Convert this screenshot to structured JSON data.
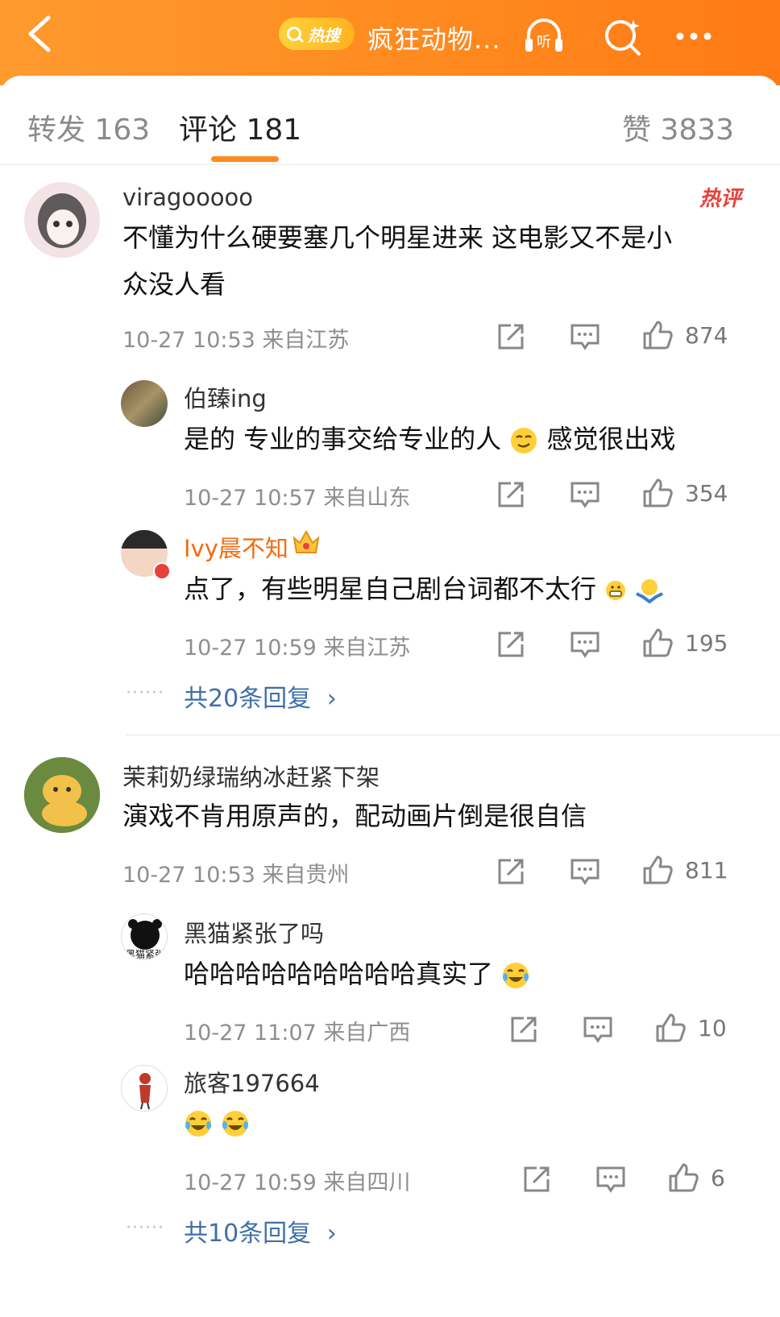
{
  "header": {
    "hot_search_label": "热搜",
    "title": "疯狂动物..."
  },
  "tabs": {
    "repost": "转发 163",
    "comments": "评论 181",
    "likes": "赞 3833"
  },
  "hot_badge": "热评",
  "comments": [
    {
      "user": "viragooooo",
      "text_line1": "不懂为什么硬要塞几个明星进来 这电影又不是小",
      "text_line2": "众没人看",
      "meta": "10-27 10:53  来自江苏",
      "likes": "874",
      "replies": [
        {
          "user": "伯臻ing",
          "text": "是的 专业的事交给专业的人",
          "text_after": "感觉很出戏",
          "meta": "10-27 10:57  来自山东",
          "likes": "354"
        },
        {
          "user": "Ivy晨不知",
          "text": "点了，有些明星自己剧台词都不太行",
          "meta": "10-27 10:59  来自江苏",
          "likes": "195"
        }
      ],
      "more": "共20条回复"
    },
    {
      "user": "茉莉奶绿瑞纳冰赶紧下架",
      "text": "演戏不肯用原声的，配动画片倒是很自信",
      "meta": "10-27 10:53  来自贵州",
      "likes": "811",
      "replies": [
        {
          "user": "黑猫紧张了吗",
          "avatar_text": "黑猫紧张",
          "text": "哈哈哈哈哈哈哈哈哈真实了",
          "meta": "10-27 11:07  来自广西",
          "likes": "10"
        },
        {
          "user": "旅客197664",
          "text": "",
          "meta": "10-27 10:59  来自四川",
          "likes": "6"
        }
      ],
      "more": "共10条回复"
    }
  ],
  "more_arrow": "›",
  "dots": "······"
}
